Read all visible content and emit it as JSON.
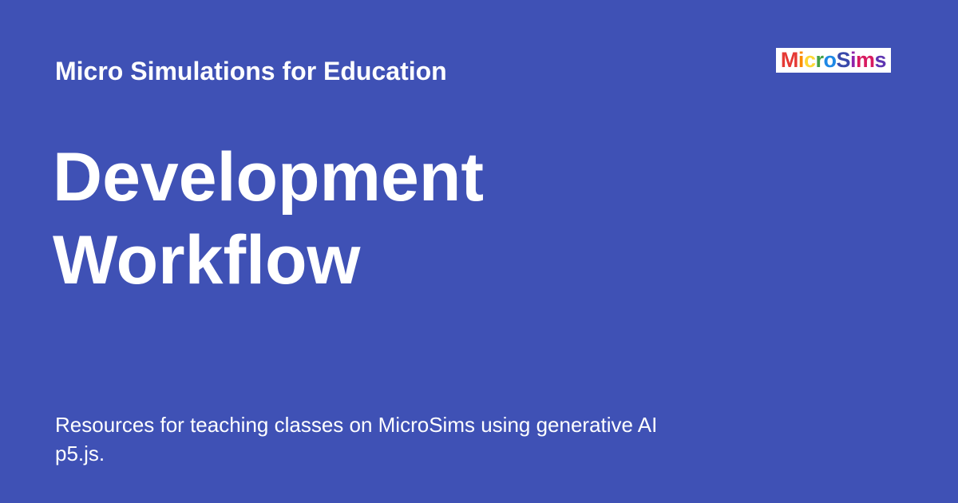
{
  "site_name": "Micro Simulations for Education",
  "logo": {
    "text": "MicroSims",
    "letter_colors": [
      "#e53935",
      "#fb8c00",
      "#fdd835",
      "#43a047",
      "#1e88e5",
      "#3949ab",
      "#8e24aa",
      "#d81b60",
      "#5e35b1"
    ]
  },
  "title": {
    "line1": "Development",
    "line2": "Workflow"
  },
  "description": {
    "line1": "Resources for teaching classes on MicroSims using generative AI",
    "line2": "p5.js."
  },
  "colors": {
    "background": "#3f51b5",
    "text": "#ffffff"
  }
}
